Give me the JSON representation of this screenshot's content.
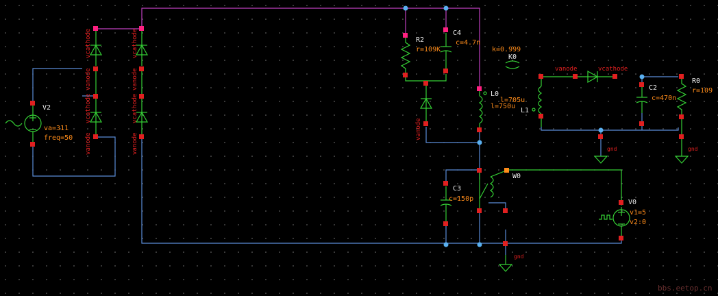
{
  "components": {
    "V2": {
      "name": "V2",
      "p1": "va=311",
      "p2": "freq=50"
    },
    "R2": {
      "name": "R2",
      "p1": "r=109K"
    },
    "C4": {
      "name": "C4",
      "p1": "c=4.7n"
    },
    "K0": {
      "name": "K0",
      "p1": "k=0.999"
    },
    "L0": {
      "name": "L0",
      "p1": "l=705u",
      "p2": "l=750u"
    },
    "L1": {
      "name": "L1"
    },
    "C2": {
      "name": "C2",
      "p1": "c=470n"
    },
    "R0": {
      "name": "R0",
      "p1": "r=109"
    },
    "C3": {
      "name": "C3",
      "p1": "c=150p"
    },
    "W0": {
      "name": "W0"
    },
    "V0": {
      "name": "V0",
      "p1": "v1=5",
      "p2": "v2:0"
    }
  },
  "pins": {
    "vcathode": "vcathode",
    "vanode": "vanode",
    "gnd": "gnd"
  },
  "watermark": "bbs.eetop.cn",
  "colors": {
    "background": "#000000",
    "wire": "#5b8dd8",
    "component": "#35d035",
    "supply_wire": "#c040c0",
    "pin_red": "#e02020",
    "label_white": "#e8e8e8",
    "prop_orange": "#ff8c1a"
  }
}
